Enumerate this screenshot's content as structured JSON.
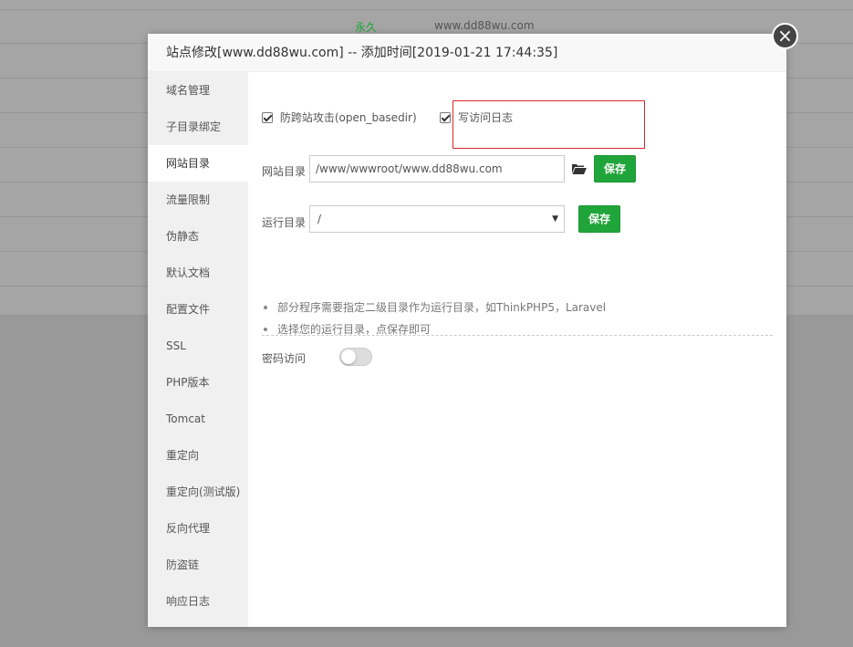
{
  "background": {
    "row": {
      "expiry": "永久",
      "domain": "www.dd88wu.com"
    }
  },
  "modal": {
    "title": "站点修改[www.dd88wu.com] -- 添加时间[2019-01-21 17:44:35]",
    "close_label": "×"
  },
  "sidebar": {
    "items": [
      {
        "label": "域名管理",
        "active": false
      },
      {
        "label": "子目录绑定",
        "active": false
      },
      {
        "label": "网站目录",
        "active": true
      },
      {
        "label": "流量限制",
        "active": false
      },
      {
        "label": "伪静态",
        "active": false
      },
      {
        "label": "默认文档",
        "active": false
      },
      {
        "label": "配置文件",
        "active": false
      },
      {
        "label": "SSL",
        "active": false
      },
      {
        "label": "PHP版本",
        "active": false
      },
      {
        "label": "Tomcat",
        "active": false
      },
      {
        "label": "重定向",
        "active": false
      },
      {
        "label": "重定向(测试版)",
        "active": false
      },
      {
        "label": "反向代理",
        "active": false
      },
      {
        "label": "防盗链",
        "active": false
      },
      {
        "label": "响应日志",
        "active": false
      }
    ]
  },
  "site_dir": {
    "checkbox_basedir": {
      "label": "防跨站攻击(open_basedir)",
      "checked": true
    },
    "checkbox_log": {
      "label": "写访问日志",
      "checked": true
    },
    "dir_label": "网站目录",
    "dir_value": "/www/wwwroot/www.dd88wu.com",
    "save_label": "保存",
    "run_dir_label": "运行目录",
    "run_dir_value": "/",
    "run_save_label": "保存",
    "tips": [
      "部分程序需要指定二级目录作为运行目录，如ThinkPHP5，Laravel",
      "选择您的运行目录，点保存即可"
    ],
    "password_access_label": "密码访问",
    "password_access_enabled": false
  },
  "colors": {
    "primary_green": "#20a53a",
    "highlight_red": "#d9282f"
  }
}
